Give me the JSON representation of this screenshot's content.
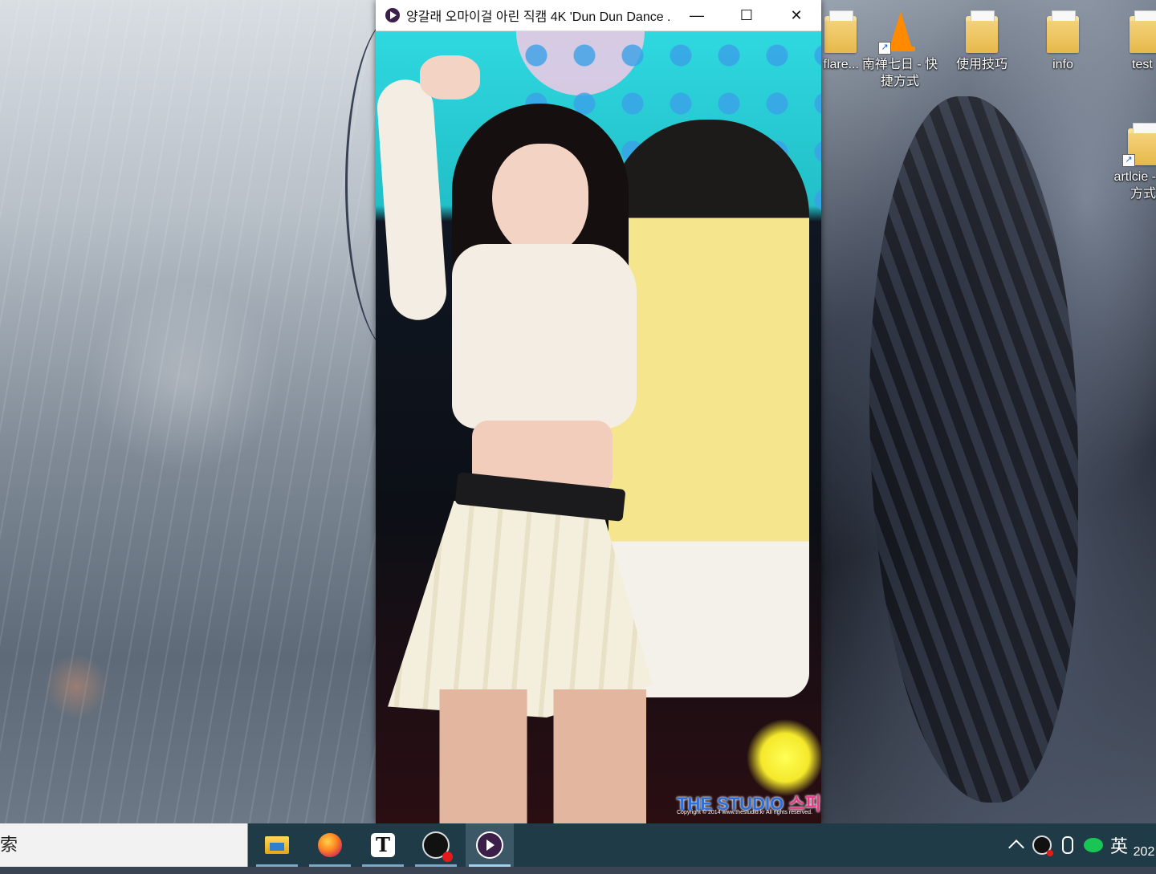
{
  "desktop": {
    "icons": [
      {
        "name": "desktop-icon-flare",
        "label": "flare...",
        "type": "folder"
      },
      {
        "name": "desktop-icon-nanchan",
        "label": "南禅七日 - 快捷方式",
        "type": "vlc-shortcut"
      },
      {
        "name": "desktop-icon-tips",
        "label": "使用技巧",
        "type": "folder"
      },
      {
        "name": "desktop-icon-info",
        "label": "info",
        "type": "folder"
      },
      {
        "name": "desktop-icon-test",
        "label": "test",
        "type": "folder"
      },
      {
        "name": "desktop-icon-artlcie",
        "label": "artlcie - 方式",
        "type": "folder-shortcut"
      }
    ]
  },
  "player": {
    "title": "양갈래 오마이걸 아린 직캠 4K 'Dun Dun Dance ...",
    "minimize": "—",
    "maximize": "☐",
    "close": "✕",
    "watermark": "THE STUDIO",
    "watermark_kr": "스피넬",
    "copyright": "Copyright © 2014 www.thestudio.kr All rights reserved."
  },
  "taskbar": {
    "search_text": "索",
    "apps": [
      "file-explorer",
      "firefox",
      "typora",
      "obs-studio",
      "media-player"
    ],
    "tray": {
      "ime": "英",
      "clock": "202"
    }
  }
}
